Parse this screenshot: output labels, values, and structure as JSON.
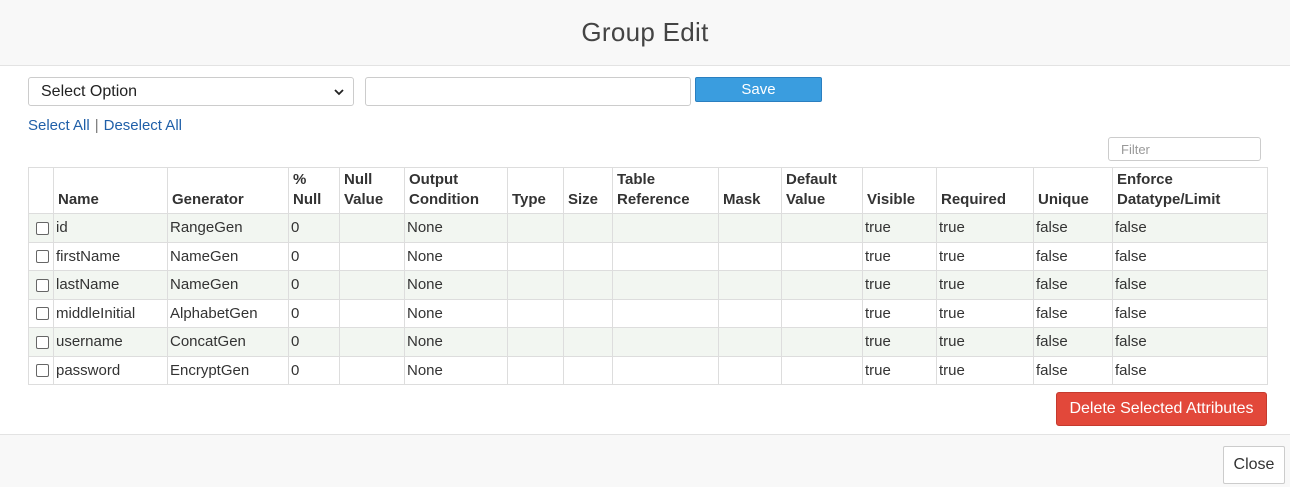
{
  "modal": {
    "title": "Group Edit"
  },
  "toolbar": {
    "select_value": "Select Option",
    "text_value": "",
    "save_label": "Save"
  },
  "links": {
    "select_all": "Select All",
    "separator": "|",
    "deselect_all": "Deselect All"
  },
  "filter": {
    "placeholder": "Filter"
  },
  "table": {
    "headers": [
      "",
      "Name",
      "Generator",
      "% Null",
      "Null Value",
      "Output Condition",
      "Type",
      "Size",
      "Table Reference",
      "Mask",
      "Default Value",
      "Visible",
      "Required",
      "Unique",
      "Enforce Datatype/Limit"
    ],
    "rows": [
      [
        "id",
        "RangeGen",
        "0",
        "",
        "None",
        "",
        "",
        "",
        "",
        "",
        "true",
        "true",
        "false",
        "false"
      ],
      [
        "firstName",
        "NameGen",
        "0",
        "",
        "None",
        "",
        "",
        "",
        "",
        "",
        "true",
        "true",
        "false",
        "false"
      ],
      [
        "lastName",
        "NameGen",
        "0",
        "",
        "None",
        "",
        "",
        "",
        "",
        "",
        "true",
        "true",
        "false",
        "false"
      ],
      [
        "middleInitial",
        "AlphabetGen",
        "0",
        "",
        "None",
        "",
        "",
        "",
        "",
        "",
        "true",
        "true",
        "false",
        "false"
      ],
      [
        "username",
        "ConcatGen",
        "0",
        "",
        "None",
        "",
        "",
        "",
        "",
        "",
        "true",
        "true",
        "false",
        "false"
      ],
      [
        "password",
        "EncryptGen",
        "0",
        "",
        "None",
        "",
        "",
        "",
        "",
        "",
        "true",
        "true",
        "false",
        "false"
      ]
    ]
  },
  "actions": {
    "delete_label": "Delete Selected Attributes",
    "close_label": "Close"
  },
  "colors": {
    "save": "#3a9ddf",
    "delete": "#e2483a",
    "link": "#1f5fa8",
    "row_stripe": "#f2f6f1"
  }
}
